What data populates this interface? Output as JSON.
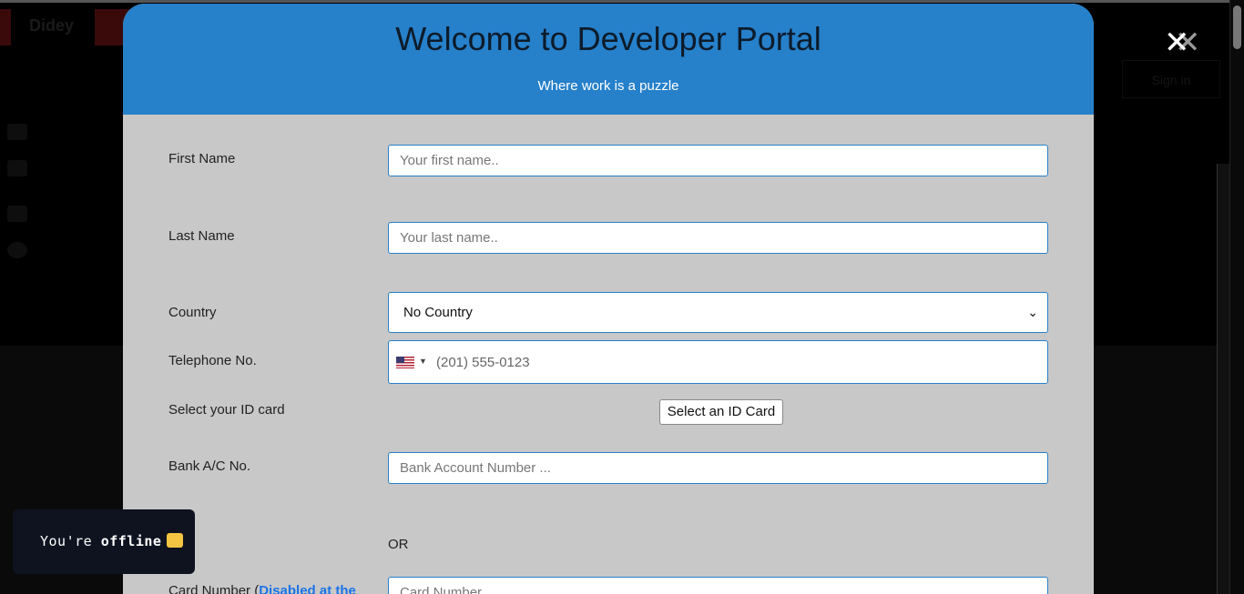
{
  "background": {
    "brand": "Didey",
    "signin_label": "Sign in"
  },
  "modal": {
    "title": "Welcome to Developer Portal",
    "subtitle": "Where work is a puzzle",
    "close_icon": "close-icon",
    "fields": {
      "first_name": {
        "label": "First Name",
        "placeholder": "Your first name.."
      },
      "last_name": {
        "label": "Last Name",
        "placeholder": "Your last name.."
      },
      "country": {
        "label": "Country",
        "selected": "No Country"
      },
      "telephone": {
        "label": "Telephone No.",
        "placeholder": "(201) 555-0123",
        "flag": "us-flag-icon"
      },
      "id_card": {
        "label": "Select your ID card",
        "button": "Select an ID Card"
      },
      "bank": {
        "label": "Bank A/C No.",
        "placeholder": "Bank Account Number ..."
      },
      "or_text": "OR",
      "card": {
        "label_prefix": "Card Number (",
        "label_link": "Disabled at the",
        "placeholder": "Card Number .."
      }
    }
  },
  "toast": {
    "prefix": "You're ",
    "status": "offline",
    "emoji": "sad-face-icon"
  },
  "colors": {
    "header_blue": "#2680ca",
    "form_bg": "#c8c8c8",
    "toast_bg": "#0f1320"
  }
}
